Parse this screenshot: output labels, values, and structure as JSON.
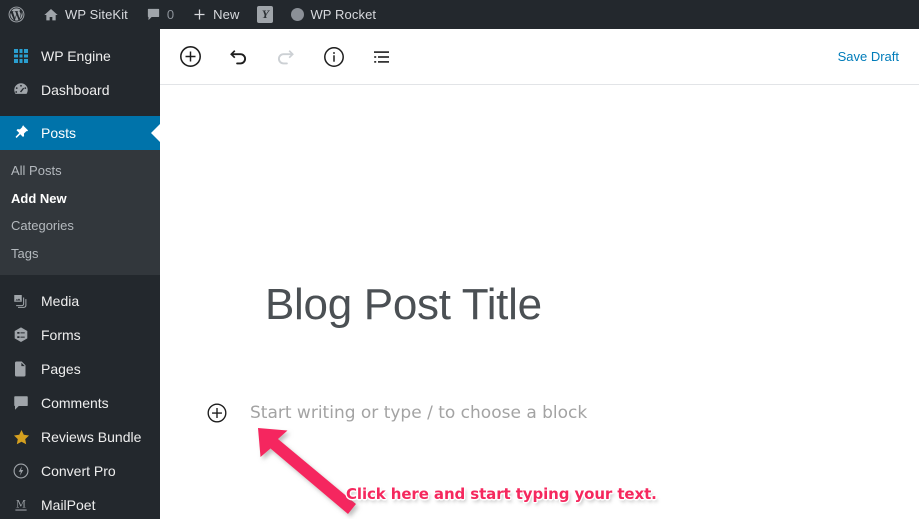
{
  "adminbar": {
    "items": [
      {
        "icon": "wordpress-logo-icon",
        "label": "",
        "type": "logo"
      },
      {
        "icon": "home-icon",
        "label": "WP SiteKit",
        "type": "site"
      },
      {
        "icon": "comment-bubble-icon",
        "label": "",
        "count": "0",
        "type": "comments"
      },
      {
        "icon": "plus-icon",
        "label": "New",
        "type": "new"
      },
      {
        "icon": "yoast-icon",
        "label": "",
        "type": "yoast"
      },
      {
        "icon": "circle-icon",
        "label": "WP Rocket",
        "type": "rocket"
      }
    ]
  },
  "sidebar": {
    "items": [
      {
        "label": "WP Engine",
        "icon": "wp-engine-icon",
        "current": false
      },
      {
        "label": "Dashboard",
        "icon": "dashboard-icon",
        "current": false
      },
      {
        "label": "Posts",
        "icon": "pin-icon",
        "current": true
      },
      {
        "label": "Media",
        "icon": "media-icon",
        "current": false
      },
      {
        "label": "Forms",
        "icon": "forms-icon",
        "current": false
      },
      {
        "label": "Pages",
        "icon": "pages-icon",
        "current": false
      },
      {
        "label": "Comments",
        "icon": "comments-icon",
        "current": false
      },
      {
        "label": "Reviews Bundle",
        "icon": "star-icon",
        "current": false
      },
      {
        "label": "Convert Pro",
        "icon": "convert-pro-icon",
        "current": false
      },
      {
        "label": "MailPoet",
        "icon": "mailpoet-icon",
        "current": false
      }
    ],
    "submenu": [
      {
        "label": "All Posts",
        "current": false
      },
      {
        "label": "Add New",
        "current": true
      },
      {
        "label": "Categories",
        "current": false
      },
      {
        "label": "Tags",
        "current": false
      }
    ]
  },
  "toolbar": {
    "buttons": [
      {
        "name": "add-block-button",
        "icon": "plus-circle-icon",
        "disabled": false
      },
      {
        "name": "undo-button",
        "icon": "undo-icon",
        "disabled": false
      },
      {
        "name": "redo-button",
        "icon": "redo-icon",
        "disabled": true
      },
      {
        "name": "details-button",
        "icon": "info-circle-icon",
        "disabled": false
      },
      {
        "name": "list-view-button",
        "icon": "list-view-icon",
        "disabled": false
      }
    ],
    "save_draft_label": "Save Draft"
  },
  "editor": {
    "post_title": "Blog Post Title",
    "block_placeholder": "Start writing or type / to choose a block"
  },
  "annotation": {
    "text": "Click here and start typing your text.",
    "color": "#f5285e"
  },
  "colors": {
    "adminbar_bg": "#23282d",
    "sidebar_bg": "#23282d",
    "submenu_bg": "#32373c",
    "active_blue": "#0073aa",
    "link_blue": "#007cba",
    "annotation_pink": "#f5285e"
  }
}
